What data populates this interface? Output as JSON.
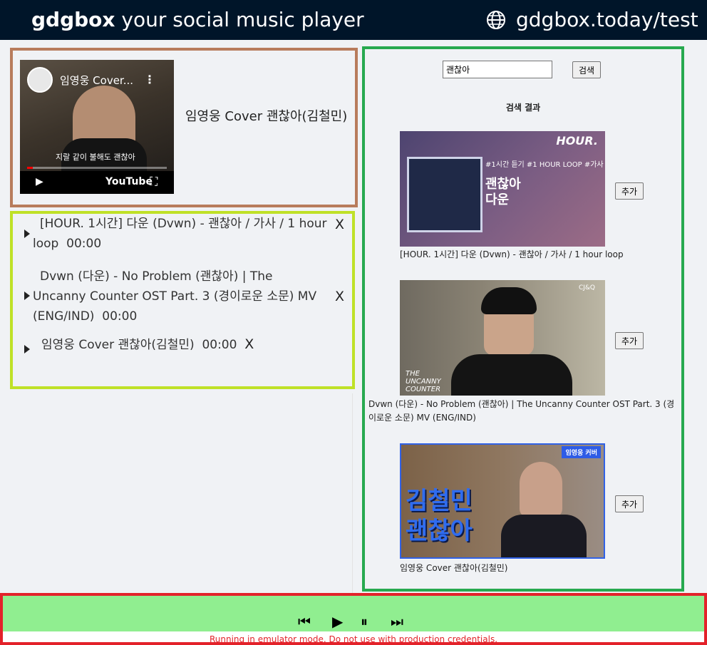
{
  "header": {
    "brand_bold": "gdgbox",
    "brand_rest": " your social music player",
    "site_url": "gdgbox.today/test",
    "globe_icon": "globe-icon"
  },
  "now_playing": {
    "video_title_overlay": "임영웅 Cover...",
    "video_caption": "지랄 같이 불해도 괜찮아",
    "video_logo": "YouTube",
    "title": "임영웅 Cover 괜찮아(김철민)"
  },
  "playlist": {
    "items": [
      {
        "title": "[HOUR. 1시간] 다운 (Dvwn) - 괜찮아 / 가사 / 1 hour loop",
        "duration": "00:00"
      },
      {
        "title": "Dvwn (다운) - No Problem (괜찮아) | The Uncanny Counter OST Part. 3 (경이로운 소문) MV (ENG/IND)",
        "duration": "00:00"
      },
      {
        "title": "임영웅 Cover 괜찮아(김철민)",
        "duration": "00:00"
      }
    ],
    "remove_label": "X"
  },
  "search": {
    "query": "괜찮아",
    "button_label": "검색",
    "results_heading": "검색 결과",
    "add_label": "추가",
    "results": [
      {
        "title": "[HOUR. 1시간] 다운 (Dvwn) - 괜찮아 / 가사 / 1 hour loop",
        "thumb_text": {
          "brand": "HOUR.",
          "tag": "#1시간 듣기 #1 HOUR LOOP #가사",
          "big": "괜찮아\n다운"
        }
      },
      {
        "title": "Dvwn (다운) - No Problem (괜찮아) | The Uncanny Counter OST Part. 3 (경이로운 소문) MV (ENG/IND)",
        "thumb_text": {
          "logo": "THE UNCANNY COUNTER",
          "corner": "CJ&Q"
        }
      },
      {
        "title": "임영웅 Cover 괜찮아(김철민)",
        "thumb_text": {
          "tag": "임영웅 커버",
          "big": "김철민\n괜찮아"
        }
      }
    ]
  },
  "player_bar": {
    "controls": [
      "⏮",
      "▶",
      "⏸",
      "⏭"
    ],
    "warning": "Running in emulator mode. Do not use with production credentials."
  },
  "colors": {
    "header_bg": "#001529",
    "now_playing_border": "#b87c5c",
    "playlist_border": "#bfe127",
    "search_border": "#27a94f",
    "player_border": "#e3222a",
    "player_bg": "#90ee90"
  }
}
